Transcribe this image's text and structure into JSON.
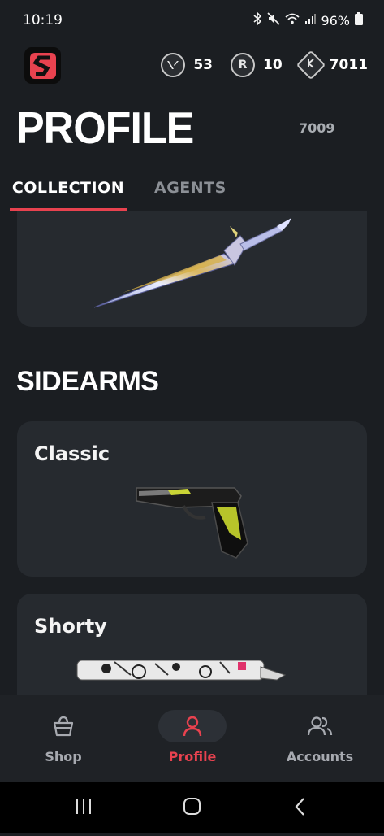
{
  "status": {
    "time": "10:19",
    "battery": "96%"
  },
  "currencies": [
    {
      "icon": "valorant-points-icon",
      "value": "53"
    },
    {
      "icon": "radianite-icon",
      "value": "10"
    },
    {
      "icon": "kingdom-credits-icon",
      "value": "7011"
    }
  ],
  "page": {
    "title": "PROFILE",
    "player_id": "7009"
  },
  "tabs": {
    "collection": "COLLECTION",
    "agents": "AGENTS"
  },
  "sections": {
    "sidearms": "SIDEARMS"
  },
  "weapons": {
    "classic": "Classic",
    "shorty": "Shorty"
  },
  "nav": {
    "shop": "Shop",
    "profile": "Profile",
    "accounts": "Accounts"
  },
  "colors": {
    "accent": "#e8424f",
    "background": "#1b1e22",
    "card": "#262a2f"
  }
}
